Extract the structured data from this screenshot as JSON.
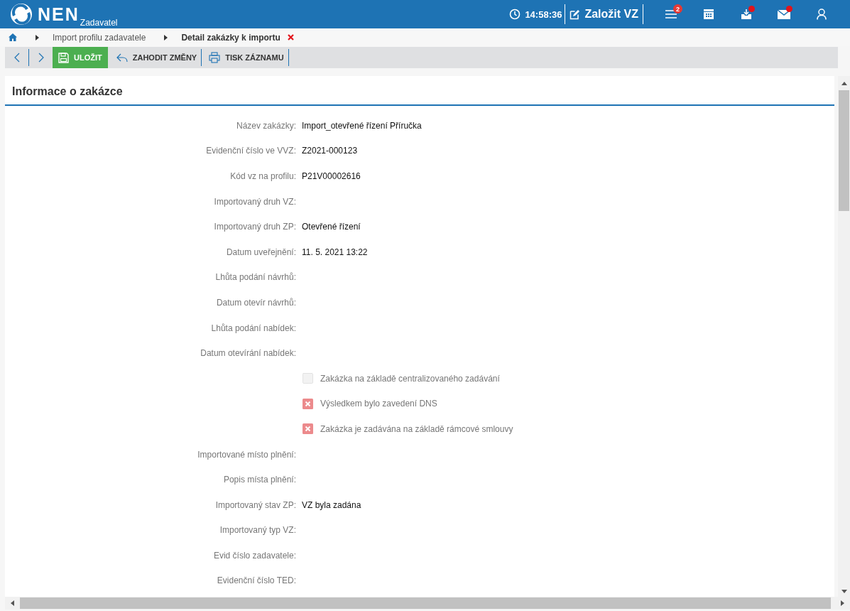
{
  "header": {
    "logo_text": "NEN",
    "logo_subtitle": "Zadavatel",
    "clock": "14:58:36",
    "create_button": "Založit VZ",
    "menu_badge": "2",
    "inbox_dot": true,
    "mail_dot": true
  },
  "breadcrumbs": [
    {
      "label": "Import profilu zadavatele",
      "current": false
    },
    {
      "label": "Detail zakázky k importu",
      "current": true
    }
  ],
  "toolbar": [
    {
      "label": "ULOŽIT",
      "kind": "save",
      "primary": true
    },
    {
      "label": "ZAHODIT ZMĚNY",
      "kind": "undo",
      "primary": false
    },
    {
      "label": "TISK ZÁZNAMU",
      "kind": "print",
      "primary": false
    }
  ],
  "section_title": "Informace o zakázce",
  "fields": [
    {
      "kind": "text",
      "label": "Název zakázky:",
      "value": "Import_otevřené řízení Příručka"
    },
    {
      "kind": "text",
      "label": "Evidenční číslo ve VVZ:",
      "value": "Z2021-000123"
    },
    {
      "kind": "text",
      "label": "Kód vz na profilu:",
      "value": "P21V00002616"
    },
    {
      "kind": "text",
      "label": "Importovaný druh VZ:"
    },
    {
      "kind": "text",
      "label": "Importovaný druh ZP:",
      "value": "Otevřené řízení"
    },
    {
      "kind": "text",
      "label": "Datum uveřejnění:",
      "value": "11. 5. 2021 13:22"
    },
    {
      "kind": "text",
      "label": "Lhůta podání návrhů:"
    },
    {
      "kind": "text",
      "label": "Datum otevír návrhů:"
    },
    {
      "kind": "text",
      "label": "Lhůta podání nabídek:"
    },
    {
      "kind": "text",
      "label": "Datum otevírání nabídek:"
    },
    {
      "kind": "check",
      "label": "Zakázka na základě centralizovaného zadávání",
      "checked": false,
      "disabled": true
    },
    {
      "kind": "check",
      "label": "Výsledkem bylo zavedení DNS",
      "checked": false,
      "disabled": false
    },
    {
      "kind": "check",
      "label": "Zakázka je zadávána na základě rámcové smlouvy",
      "checked": false,
      "disabled": false
    },
    {
      "kind": "text",
      "label": "Importované místo plnění:"
    },
    {
      "kind": "text",
      "label": "Popis místa plnění:"
    },
    {
      "kind": "text",
      "label": "Importovaný stav ZP:",
      "value": "VZ byla zadána"
    },
    {
      "kind": "text",
      "label": "Importovaný typ VZ:"
    },
    {
      "kind": "text",
      "label": "Evid číslo zadavatele:"
    },
    {
      "kind": "text",
      "label": "Evidenční číslo TED:"
    }
  ]
}
